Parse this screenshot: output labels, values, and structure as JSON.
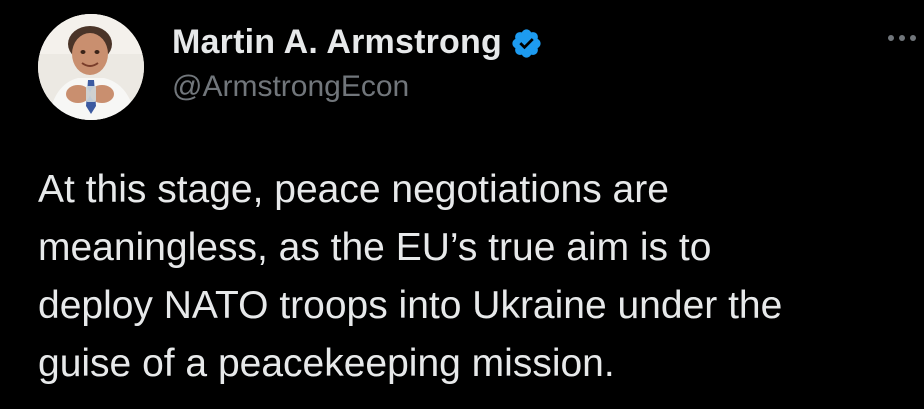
{
  "author": {
    "display_name": "Martin A. Armstrong",
    "handle": "@ArmstrongEcon",
    "verified": true,
    "avatar_icon": "profile-photo"
  },
  "tweet": {
    "lines": [
      "At this stage, peace negotiations are",
      "meaningless, as the EU’s true aim is to",
      "deploy NATO troops into Ukraine under the",
      "guise of a peacekeeping mission."
    ]
  },
  "menu": {
    "icon": "more-options-icon"
  },
  "colors": {
    "background": "#000000",
    "text_primary": "#e7e9ea",
    "text_secondary": "#71767b",
    "verified_badge": "#1d9bf0"
  }
}
